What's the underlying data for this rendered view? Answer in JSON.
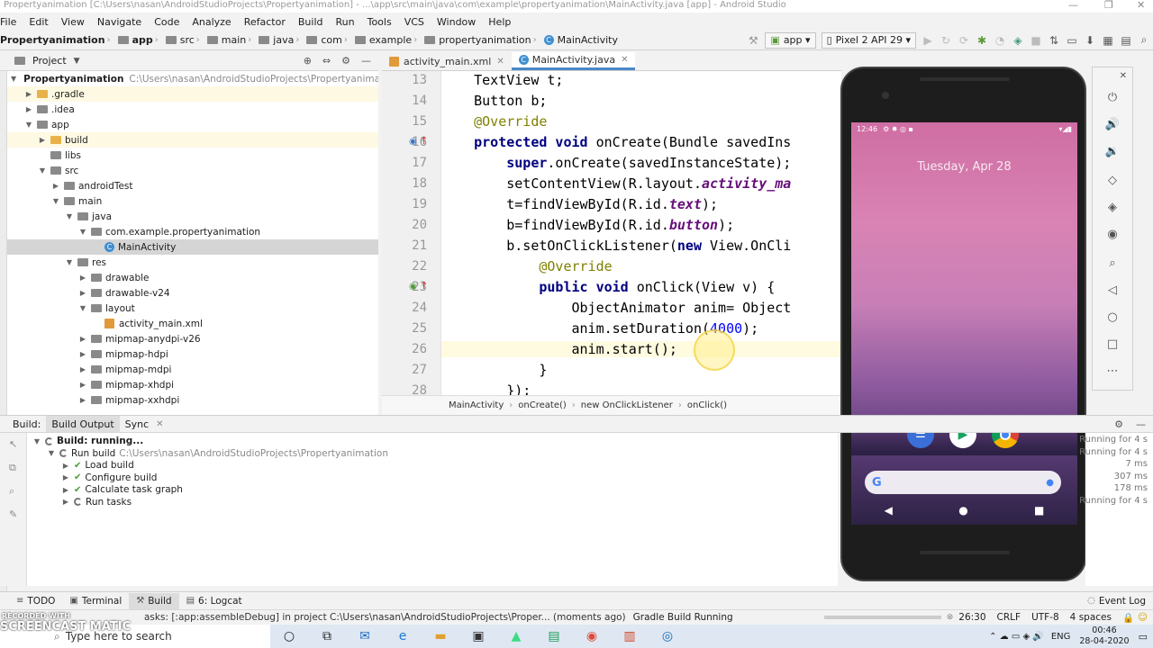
{
  "window": {
    "title": "Propertyanimation [C:\\Users\\nasan\\AndroidStudioProjects\\Propertyanimation] - ...\\app\\src\\main\\java\\com\\example\\propertyanimation\\MainActivity.java [app] - Android Studio"
  },
  "menu": [
    "File",
    "Edit",
    "View",
    "Navigate",
    "Code",
    "Analyze",
    "Refactor",
    "Build",
    "Run",
    "Tools",
    "VCS",
    "Window",
    "Help"
  ],
  "breadcrumb": [
    "Propertyanimation",
    "app",
    "src",
    "main",
    "java",
    "com",
    "example",
    "propertyanimation",
    "MainActivity"
  ],
  "toolbar": {
    "config": "app",
    "device": "Pixel 2 API 29"
  },
  "project": {
    "header": "Project",
    "rows": [
      {
        "label": "Propertyanimation",
        "path": "C:\\Users\\nasan\\AndroidStudioProjects\\Propertyanimation",
        "indent": 0,
        "arrow": "▼",
        "type": "folder"
      },
      {
        "label": ".gradle",
        "path": "",
        "indent": 1,
        "arrow": "▶",
        "type": "folder-y"
      },
      {
        "label": ".idea",
        "path": "",
        "indent": 1,
        "arrow": "▶",
        "type": "folder"
      },
      {
        "label": "app",
        "path": "",
        "indent": 1,
        "arrow": "▼",
        "type": "folder"
      },
      {
        "label": "build",
        "path": "",
        "indent": 2,
        "arrow": "▶",
        "type": "folder-y"
      },
      {
        "label": "libs",
        "path": "",
        "indent": 2,
        "arrow": "",
        "type": "folder"
      },
      {
        "label": "src",
        "path": "",
        "indent": 2,
        "arrow": "▼",
        "type": "folder"
      },
      {
        "label": "androidTest",
        "path": "",
        "indent": 3,
        "arrow": "▶",
        "type": "folder"
      },
      {
        "label": "main",
        "path": "",
        "indent": 3,
        "arrow": "▼",
        "type": "folder"
      },
      {
        "label": "java",
        "path": "",
        "indent": 4,
        "arrow": "▼",
        "type": "folder"
      },
      {
        "label": "com.example.propertyanimation",
        "path": "",
        "indent": 5,
        "arrow": "▼",
        "type": "folder"
      },
      {
        "label": "MainActivity",
        "path": "",
        "indent": 6,
        "arrow": "",
        "type": "class"
      },
      {
        "label": "res",
        "path": "",
        "indent": 4,
        "arrow": "▼",
        "type": "folder"
      },
      {
        "label": "drawable",
        "path": "",
        "indent": 5,
        "arrow": "▶",
        "type": "folder"
      },
      {
        "label": "drawable-v24",
        "path": "",
        "indent": 5,
        "arrow": "▶",
        "type": "folder"
      },
      {
        "label": "layout",
        "path": "",
        "indent": 5,
        "arrow": "▼",
        "type": "folder"
      },
      {
        "label": "activity_main.xml",
        "path": "",
        "indent": 6,
        "arrow": "",
        "type": "xml"
      },
      {
        "label": "mipmap-anydpi-v26",
        "path": "",
        "indent": 5,
        "arrow": "▶",
        "type": "folder"
      },
      {
        "label": "mipmap-hdpi",
        "path": "",
        "indent": 5,
        "arrow": "▶",
        "type": "folder"
      },
      {
        "label": "mipmap-mdpi",
        "path": "",
        "indent": 5,
        "arrow": "▶",
        "type": "folder"
      },
      {
        "label": "mipmap-xhdpi",
        "path": "",
        "indent": 5,
        "arrow": "▶",
        "type": "folder"
      },
      {
        "label": "mipmap-xxhdpi",
        "path": "",
        "indent": 5,
        "arrow": "▶",
        "type": "folder"
      }
    ]
  },
  "editor": {
    "tabs": [
      {
        "label": "activity_main.xml",
        "active": false
      },
      {
        "label": "MainActivity.java",
        "active": true
      }
    ],
    "lines": [
      {
        "n": "13",
        "html": "    TextView t;"
      },
      {
        "n": "14",
        "html": "    Button b;"
      },
      {
        "n": "15",
        "html": "    <span class=\"an\">@Override</span>"
      },
      {
        "n": "16",
        "html": "    <span class=\"kw\">protected void</span> onCreate(Bundle savedIns"
      },
      {
        "n": "17",
        "html": "        <span class=\"kw\">super</span>.onCreate(savedInstanceState);"
      },
      {
        "n": "18",
        "html": "        setContentView(R.layout.<span class=\"it\">activity_ma</span>"
      },
      {
        "n": "19",
        "html": "        t=findViewById(R.id.<span class=\"it\">text</span>);"
      },
      {
        "n": "20",
        "html": "        b=findViewById(R.id.<span class=\"it\">button</span>);"
      },
      {
        "n": "21",
        "html": "        b.setOnClickListener(<span class=\"kw\">new</span> View.OnCli"
      },
      {
        "n": "22",
        "html": "            <span class=\"an\">@Override</span>"
      },
      {
        "n": "23",
        "html": "            <span class=\"kw\">public void</span> onClick(View v) {"
      },
      {
        "n": "24",
        "html": "                ObjectAnimator anim= Object"
      },
      {
        "n": "25",
        "html": "                anim.setDuration(<span class=\"num\">4000</span>);"
      },
      {
        "n": "26",
        "html": "                anim.start();"
      },
      {
        "n": "27",
        "html": "            }"
      },
      {
        "n": "28",
        "html": "        });"
      }
    ],
    "breadcrumb": [
      "MainActivity",
      "onCreate()",
      "new OnClickListener",
      "onClick()"
    ]
  },
  "build": {
    "tabs": [
      "Build:",
      "Build Output",
      "Sync"
    ],
    "rows": [
      {
        "label": "Build: running...",
        "path": "",
        "indent": 0,
        "state": "spin",
        "bold": true
      },
      {
        "label": "Run build",
        "path": "C:\\Users\\nasan\\AndroidStudioProjects\\Propertyanimation",
        "indent": 1,
        "state": "spin",
        "bold": false
      },
      {
        "label": "Load build",
        "path": "",
        "indent": 2,
        "state": "check",
        "bold": false
      },
      {
        "label": "Configure build",
        "path": "",
        "indent": 2,
        "state": "check",
        "bold": false
      },
      {
        "label": "Calculate task graph",
        "path": "",
        "indent": 2,
        "state": "check",
        "bold": false
      },
      {
        "label": "Run tasks",
        "path": "",
        "indent": 2,
        "state": "spin",
        "bold": false
      }
    ],
    "right_log": [
      "Running for 4 s",
      "Running for 4 s",
      "7 ms",
      "307 ms",
      "178 ms",
      "Running for 4 s"
    ]
  },
  "tooltabs": [
    {
      "label": "TODO",
      "icon": "≡",
      "active": false
    },
    {
      "label": "Terminal",
      "icon": "▣",
      "active": false
    },
    {
      "label": "Build",
      "icon": "⚒",
      "active": true
    },
    {
      "label": "6: Logcat",
      "icon": "▤",
      "active": false
    }
  ],
  "event_log": "Event Log",
  "status": {
    "message": "asks: [:app:assembleDebug] in project C:\\Users\\nasan\\AndroidStudioProjects\\Proper... (moments ago)",
    "progress": "Gradle Build Running",
    "position": "26:30",
    "line_sep": "CRLF",
    "encoding": "UTF-8",
    "indent": "4 spaces"
  },
  "taskbar": {
    "search": "Type here to search",
    "lang": "ENG",
    "time": "00:46",
    "date": "28-04-2020"
  },
  "phone": {
    "status_time": "12:46",
    "date": "Tuesday, Apr 28"
  },
  "watermark": "SCREENCAST MATIC",
  "watermark_sub": "RECORDED WITH"
}
